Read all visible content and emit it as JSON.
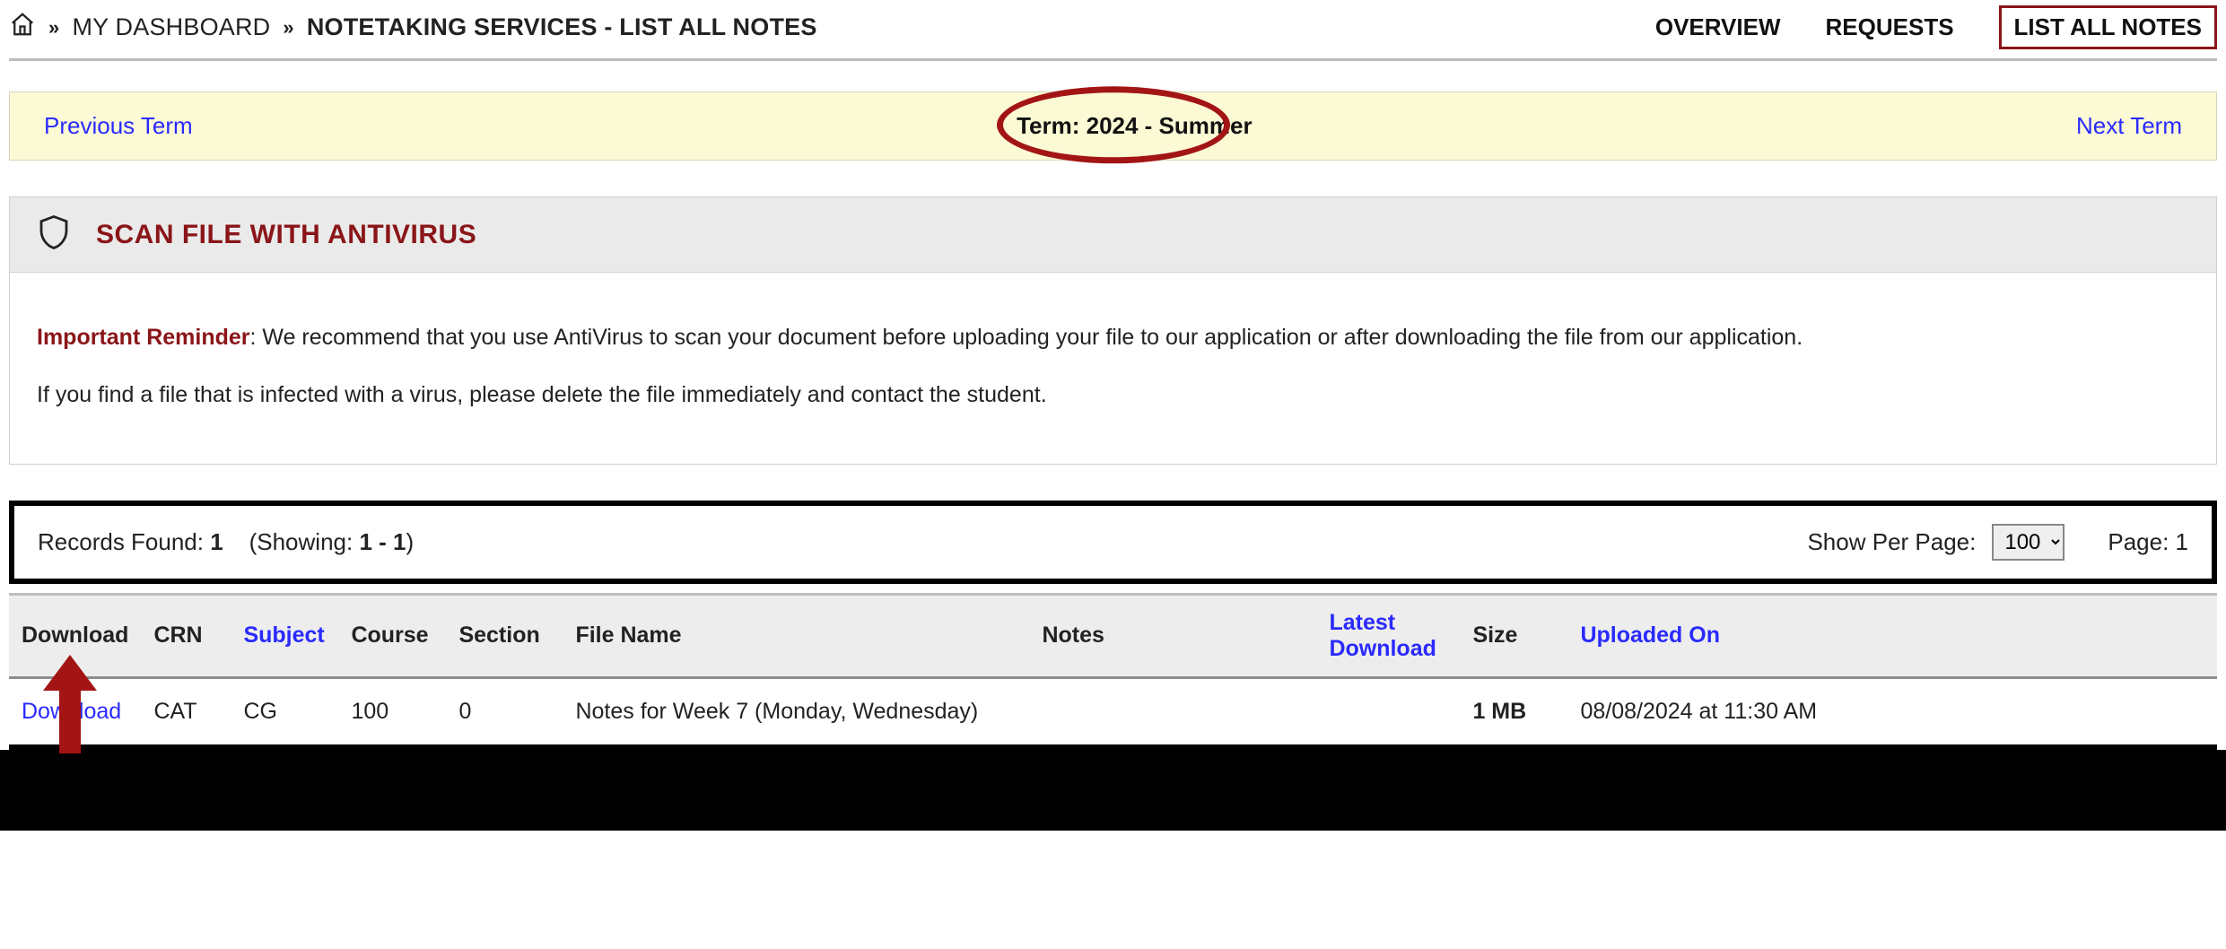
{
  "breadcrumb": {
    "dashboard": "MY DASHBOARD",
    "current": "NOTETAKING SERVICES - LIST ALL NOTES"
  },
  "topnav": {
    "overview": "OVERVIEW",
    "requests": "REQUESTS",
    "list_all": "LIST ALL NOTES"
  },
  "term_bar": {
    "prev": "Previous Term",
    "label": "Term: 2024 - Summer",
    "next": "Next Term"
  },
  "panel": {
    "title": "SCAN FILE WITH ANTIVIRUS",
    "reminder_lead": "Important Reminder",
    "reminder_text": ": We recommend that you use AntiVirus to scan your document before uploading your file to our application or after downloading the file from our application.",
    "line2": "If you find a file that is infected with a virus, please delete the file immediately and contact the student."
  },
  "records_bar": {
    "found_label": "Records Found: ",
    "found_value": "1",
    "showing_label": "(Showing: ",
    "showing_range": "1 - 1",
    "showing_close": ")",
    "per_page_label": "Show Per Page:",
    "per_page_value": "100",
    "page_label": "Page: 1"
  },
  "table": {
    "headers": {
      "download": "Download",
      "crn": "CRN",
      "subject": "Subject",
      "course": "Course",
      "section": "Section",
      "file_name": "File Name",
      "notes": "Notes",
      "latest_download": "Latest Download",
      "size": "Size",
      "uploaded_on": "Uploaded On"
    },
    "rows": [
      {
        "download": "Download",
        "crn": "CAT",
        "subject": "CG",
        "course": "100",
        "section": "0",
        "file_name": "Notes for Week 7 (Monday, Wednesday)",
        "notes": "",
        "latest_download": "",
        "size": "1 MB",
        "uploaded_on": "08/08/2024 at 11:30 AM"
      }
    ]
  }
}
